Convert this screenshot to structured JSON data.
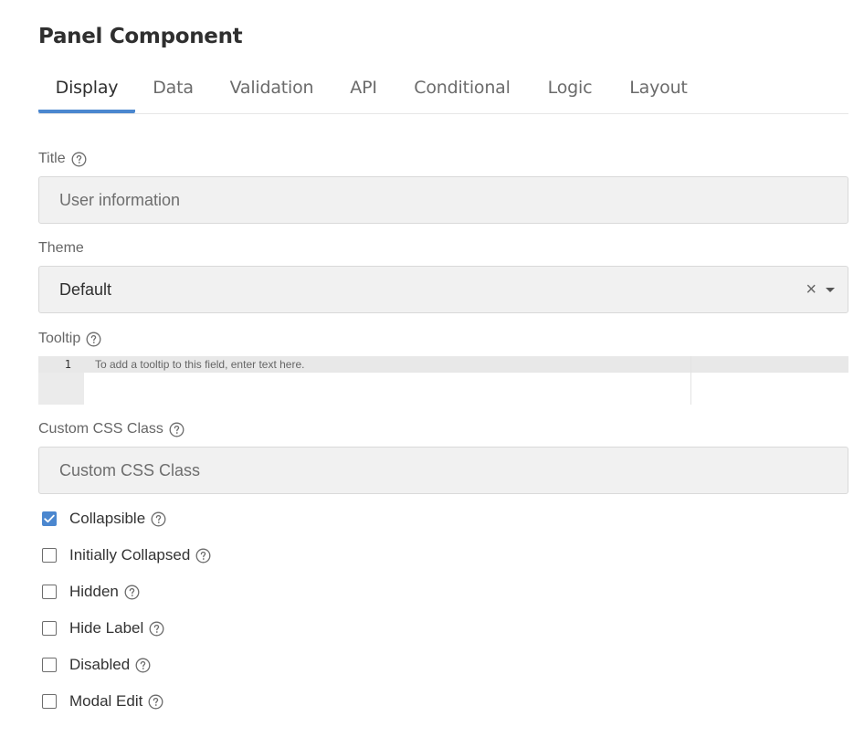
{
  "dialog": {
    "title": "Panel Component"
  },
  "tabs": [
    {
      "label": "Display",
      "active": true
    },
    {
      "label": "Data",
      "active": false
    },
    {
      "label": "Validation",
      "active": false
    },
    {
      "label": "API",
      "active": false
    },
    {
      "label": "Conditional",
      "active": false
    },
    {
      "label": "Logic",
      "active": false
    },
    {
      "label": "Layout",
      "active": false
    }
  ],
  "form": {
    "title_field": {
      "label": "Title",
      "placeholder": "User information",
      "value": ""
    },
    "theme_field": {
      "label": "Theme",
      "value": "Default"
    },
    "tooltip_field": {
      "label": "Tooltip",
      "line_number": "1",
      "placeholder": "To add a tooltip to this field, enter text here."
    },
    "custom_css_field": {
      "label": "Custom CSS Class",
      "placeholder": "Custom CSS Class"
    },
    "checkboxes": [
      {
        "label": "Collapsible",
        "checked": true
      },
      {
        "label": "Initially Collapsed",
        "checked": false
      },
      {
        "label": "Hidden",
        "checked": false
      },
      {
        "label": "Hide Label",
        "checked": false
      },
      {
        "label": "Disabled",
        "checked": false
      },
      {
        "label": "Modal Edit",
        "checked": false
      }
    ]
  },
  "icons": {
    "help": "question-circle-icon",
    "clear": "close-icon",
    "dropdown": "caret-down-icon",
    "check": "checkmark-icon"
  },
  "colors": {
    "accent": "#4b87cf",
    "input_background": "#f1f1f1"
  }
}
